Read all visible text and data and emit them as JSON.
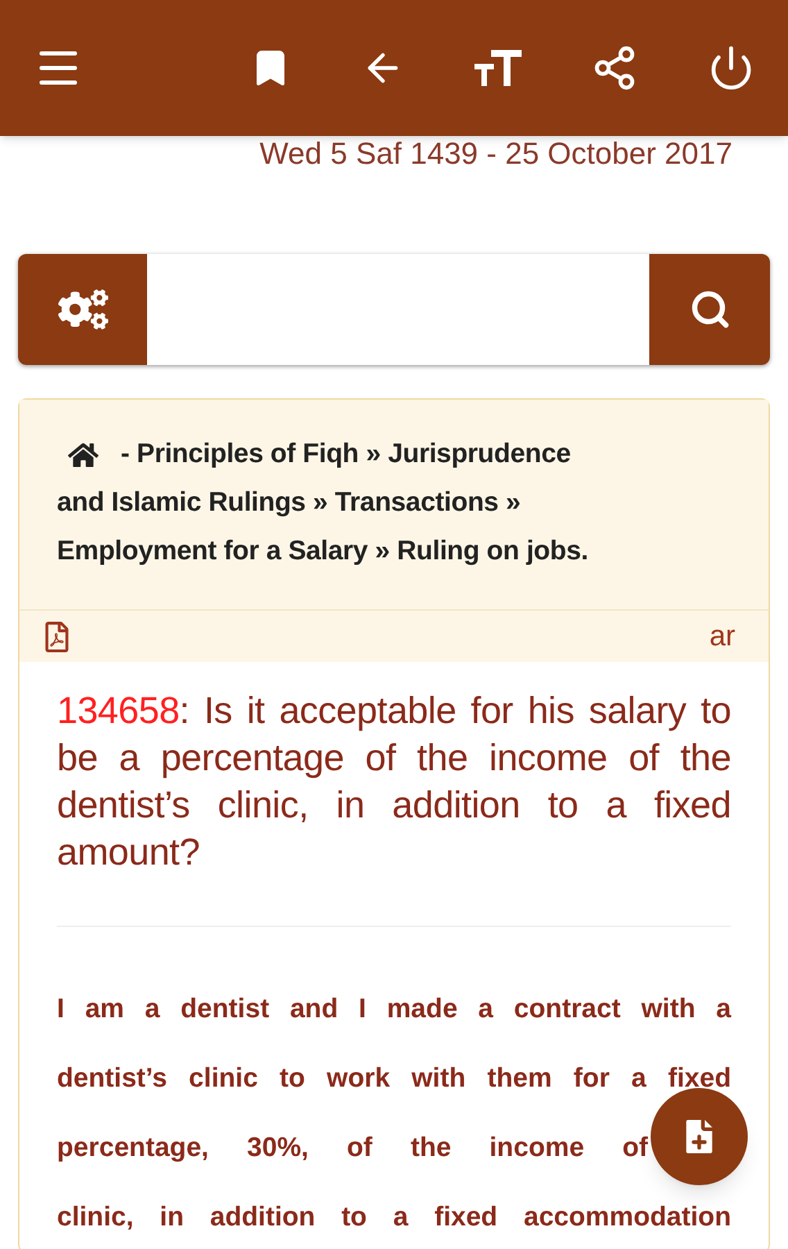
{
  "date": "Wed 5 Saf 1439 - 25 October 2017",
  "breadcrumb": {
    "lines": [
      "- Principles of Fiqh » Jurisprudence",
      "and Islamic Rulings » Transactions »",
      "Employment for a Salary » Ruling on jobs."
    ]
  },
  "language": "ar",
  "question": {
    "number": "134658",
    "title": ": Is it acceptable for his salary to be a percentage of the income of the dentist’s clinic, in addition to a fixed amount?"
  },
  "body_lines": [
    "I am a dentist and I made a contract with a",
    "dentist’s clinic to work with them for a fixed",
    "percentage, 30%, of the income of",
    "clinic, in addition to a fixed accommodation"
  ]
}
